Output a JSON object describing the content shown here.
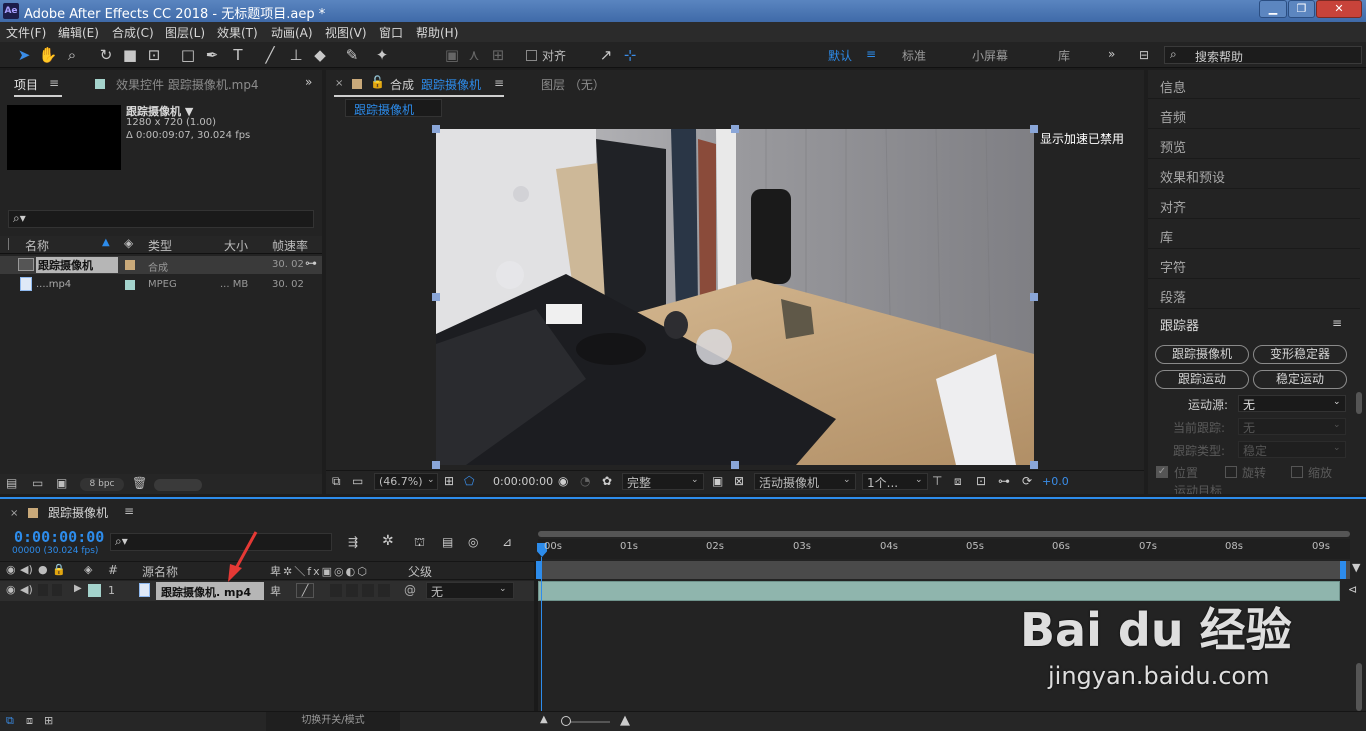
{
  "window": {
    "title": "Adobe After Effects CC 2018 - 无标题项目.aep *",
    "logo": "Ae",
    "min": "▁",
    "max": "❐",
    "close": "✕"
  },
  "menu": [
    "文件(F)",
    "编辑(E)",
    "合成(C)",
    "图层(L)",
    "效果(T)",
    "动画(A)",
    "视图(V)",
    "窗口",
    "帮助(H)"
  ],
  "toolbar": {
    "align_label": "对齐",
    "workspaces": [
      "默认",
      "标准",
      "小屏幕",
      "库"
    ],
    "more": "»",
    "search_placeholder": "搜索帮助"
  },
  "project": {
    "tab_label": "项目",
    "effects_tab": "效果控件 跟踪摄像机.mp4",
    "selected_name": "跟踪摄像机 ▼",
    "selected_res": "1280 x 720 (1.00)",
    "selected_dur": "Δ 0:00:09:07, 30.024 fps",
    "columns": [
      "名称",
      "类型",
      "大小",
      "帧速率"
    ],
    "rows": [
      {
        "name": "跟踪摄像机",
        "type": "合成",
        "size": "",
        "fps": "30. 02"
      },
      {
        "name": "....mp4",
        "type": "MPEG",
        "size": "... MB",
        "fps": "30. 02"
      }
    ],
    "bpc": "8 bpc"
  },
  "comp": {
    "tab_prefix": "合成",
    "tab_name": "跟踪摄像机",
    "layer_tab": "图层 （无）",
    "breadcrumb": "跟踪摄像机",
    "accel_notice": "显示加速已禁用",
    "zoom": "(46.7%)",
    "timecode": "0:00:00:00",
    "resolution": "完整",
    "camera": "活动摄像机",
    "views": "1个...",
    "exposure": "+0.0"
  },
  "right_panel": {
    "items": [
      "信息",
      "音频",
      "预览",
      "效果和预设",
      "对齐",
      "库",
      "字符",
      "段落"
    ],
    "tracker": {
      "title": "跟踪器",
      "buttons": [
        "跟踪摄像机",
        "变形稳定器",
        "跟踪运动",
        "稳定运动"
      ],
      "motion_source_label": "运动源:",
      "motion_source_value": "无",
      "current_track_label": "当前跟踪:",
      "current_track_value": "无",
      "track_type_label": "跟踪类型:",
      "track_type_value": "稳定",
      "position_label": "位置",
      "rotation_label": "旋转",
      "scale_label": "缩放",
      "motion_target": "运动目标"
    }
  },
  "timeline": {
    "tab_name": "跟踪摄像机",
    "timecode": "0:00:00:00",
    "frame_info": "00000 (30.024 fps)",
    "col_number": "#",
    "col_source": "源名称",
    "col_parent": "父级",
    "ruler": [
      "00s",
      "01s",
      "02s",
      "03s",
      "04s",
      "05s",
      "06s",
      "07s",
      "08s",
      "09s"
    ],
    "layer": {
      "index": "1",
      "name": "跟踪摄像机. mp4",
      "parent": "无"
    },
    "footer_toggle": "切换开关/模式"
  },
  "watermark": {
    "brand": "Bai du 经验",
    "url": "jingyan.baidu.com"
  },
  "colors": {
    "accent": "#2d8ceb",
    "selection": "#8aa6d8",
    "layer_bar": "#8fb5ad"
  }
}
